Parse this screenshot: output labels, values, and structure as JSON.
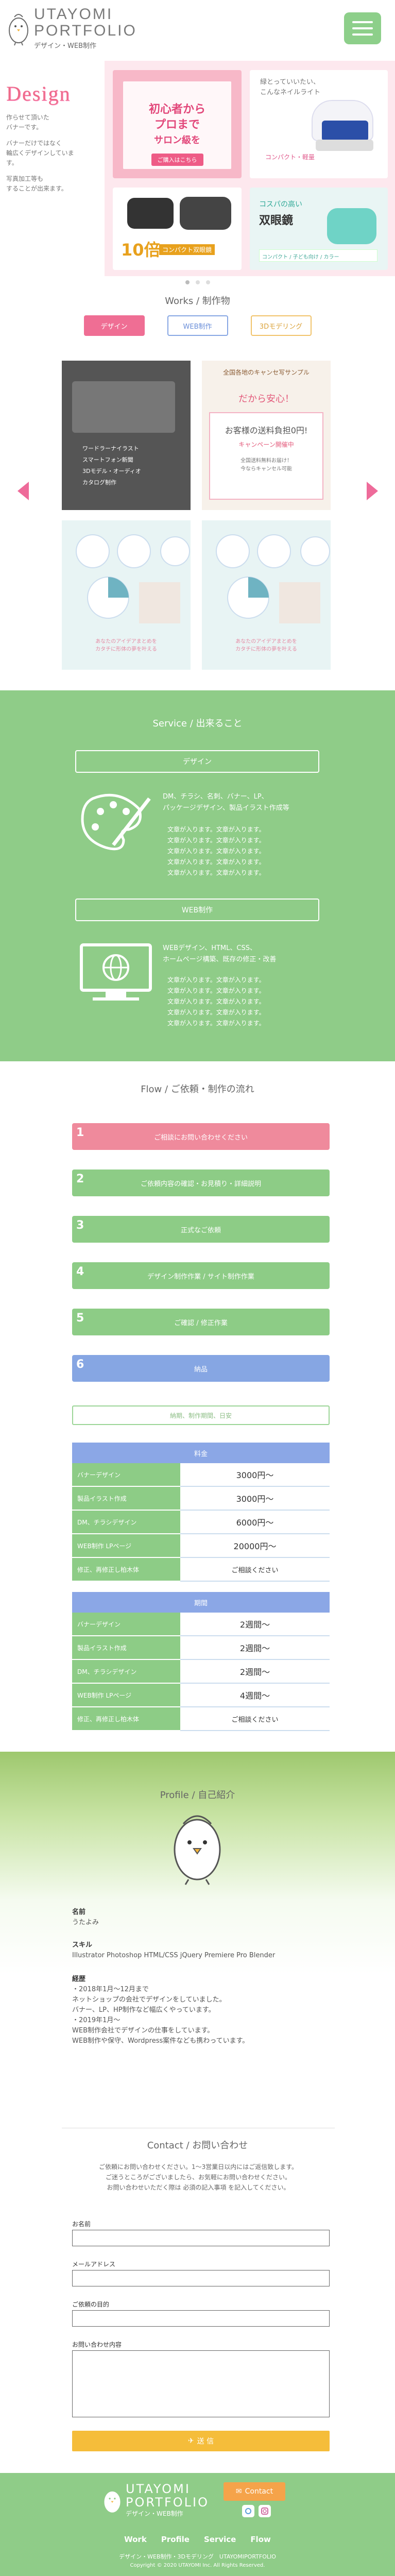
{
  "header": {
    "logo_line1": "UTAYOMI",
    "logo_line2": "PORTFOLIO",
    "logo_sub": "デザイン・WEB制作",
    "menu_icon": "hamburger-icon"
  },
  "hero": {
    "title": "Design",
    "p1": "作らせて頂いた",
    "p2": "バナーです。",
    "p3": "バナーだけではなく",
    "p4": "輪広くデザインしています。",
    "p5": "写真加工等も",
    "p6": "することが出来ます。",
    "panel1_t1": "初心者から",
    "panel1_t2": "プロまで",
    "panel1_t3": "サロン級を",
    "panel1_t4": "自宅で簡単に",
    "panel1_btn": "ご購入はこちら",
    "panel2_q1": "緑とっていいたい、",
    "panel2_q2": "こんなネイルライト",
    "panel2_t": "コンパクト・軽量",
    "panel3_big": "10倍",
    "panel3_small": "コンパクト双眼鏡",
    "panel4_c1": "双眼鏡",
    "panel4_c2": "コスパの高い",
    "panel4_c3": "双眼鏡",
    "panel4_bar": "コンパクト / 子ども向け / カラー"
  },
  "works": {
    "heading": "Works / 制作物",
    "tabs": [
      "デザイン",
      "WEB制作",
      "3Dモデリング"
    ],
    "card1_text": "ワードラーナイラスト\nスマートフォン新聞\n3Dモデル・オーディオ\nカタログ制作",
    "card2_t1": "全国各地のキャンセ写サンプル",
    "card2_t2": "だから安心！",
    "card2_big": "お客様の送料負担0円!",
    "card2_b": "キャンペーン開催中",
    "card2_c": "全国送料無料お届け！\n今ならキャンセル可能",
    "card3_footer": "あなたのアイデアまとめを\nカタチに形体の夢を叶える",
    "card4_footer": "あなたのアイデアまとめを\nカタチに形体の夢を叶える"
  },
  "service": {
    "heading": "Service / 出来ること",
    "design_title": "デザイン",
    "design_h1": "DM、チラシ、名刺、バナー、LP、",
    "design_h2": "パッケージデザイン、製品イラスト作成等",
    "design_body": [
      "文章が入ります。文章が入ります。",
      "文章が入ります。文章が入ります。",
      "文章が入ります。文章が入ります。",
      "文章が入ります。文章が入ります。",
      "文章が入ります。文章が入ります。"
    ],
    "web_title": "WEB制作",
    "web_h1": "WEBデザイン、HTML、CSS、",
    "web_h2": "ホームページ構築、既存の修正・改善",
    "web_body": [
      "文章が入ります。文章が入ります。",
      "文章が入ります。文章が入ります。",
      "文章が入ります。文章が入ります。",
      "文章が入ります。文章が入ります。",
      "文章が入ります。文章が入ります。"
    ]
  },
  "flow": {
    "heading": "Flow / ご依頼・制作の流れ",
    "steps": [
      {
        "n": "1",
        "label": "ご相談にお問い合わせください",
        "color": "#ef8a9c"
      },
      {
        "n": "2",
        "label": "ご依頼内容の確認・お見積り・詳細説明",
        "color": "#8dcc86"
      },
      {
        "n": "3",
        "label": "正式なご依頼",
        "color": "#8dcc86"
      },
      {
        "n": "4",
        "label": "デザイン制作作業 / サイト制作作業",
        "color": "#8dcc86"
      },
      {
        "n": "5",
        "label": "ご確認 / 修正作業",
        "color": "#8dcc86"
      },
      {
        "n": "6",
        "label": "納品",
        "color": "#86a6e3"
      }
    ],
    "note": "納期、制作期間、日安",
    "price_head": "料金",
    "prices": [
      {
        "item": "バナーデザイン",
        "val": "3000円〜"
      },
      {
        "item": "製品イラスト作成",
        "val": "3000円〜"
      },
      {
        "item": "DM、チラシデザイン",
        "val": "6000円〜"
      },
      {
        "item": "WEB制作 LPページ",
        "val": "20000円〜"
      },
      {
        "item": "修正、再修正し柏木体",
        "val": "ご相談ください"
      }
    ],
    "period_head": "期間",
    "periods": [
      {
        "item": "バナーデザイン",
        "val": "2週間〜"
      },
      {
        "item": "製品イラスト作成",
        "val": "2週間〜"
      },
      {
        "item": "DM、チラシデザイン",
        "val": "2週間〜"
      },
      {
        "item": "WEB制作 LPページ",
        "val": "4週間〜"
      },
      {
        "item": "修正、再修正し柏木体",
        "val": "ご相談ください"
      }
    ]
  },
  "profile": {
    "heading": "Profile / 自己紹介",
    "name_label": "名前",
    "name": "うたよみ",
    "skill_label": "スキル",
    "skill": "Illustrator Photoshop HTML/CSS jQuery Premiere Pro Blender",
    "career_label": "経歴",
    "career": [
      "・2018年1月〜12月まで",
      "ネットショップの会社でデザインをしていました。",
      "バナー、LP、HP制作など幅広くやっています。",
      "・2019年1月〜",
      "WEB制作会社でデザインの仕事をしています。",
      "WEB制作や保守、Wordpress案件なども携わっています。"
    ]
  },
  "contact": {
    "heading": "Contact / お問い合わせ",
    "intro1": "ご依頼にお問い合わせください。1〜3営業日以内にはご返信致します。",
    "intro2": "ご迷うところがございましたら、お気軽にお問い合わせください。",
    "intro3": "お問い合わせいただく際は 必須の記入事項 を記入してください。",
    "f_name": "お名前",
    "f_mail": "メールアドレス",
    "f_purpose": "ご依頼の目的",
    "f_message": "お問い合わせ内容",
    "send": "送 信"
  },
  "footer": {
    "logo_line1": "UTAYOMI",
    "logo_line2": "PORTFOLIO",
    "logo_sub": "デザイン・WEB制作",
    "contact_btn": "Contact",
    "nav": [
      "Work",
      "Profile",
      "Service",
      "Flow"
    ],
    "sub": "デザイン・WEB制作・3Dモデリング　UTAYOMIPORTFOLIO",
    "copy": "Copyright © 2020 UTAYOMI Inc. All Rights Reserved."
  }
}
